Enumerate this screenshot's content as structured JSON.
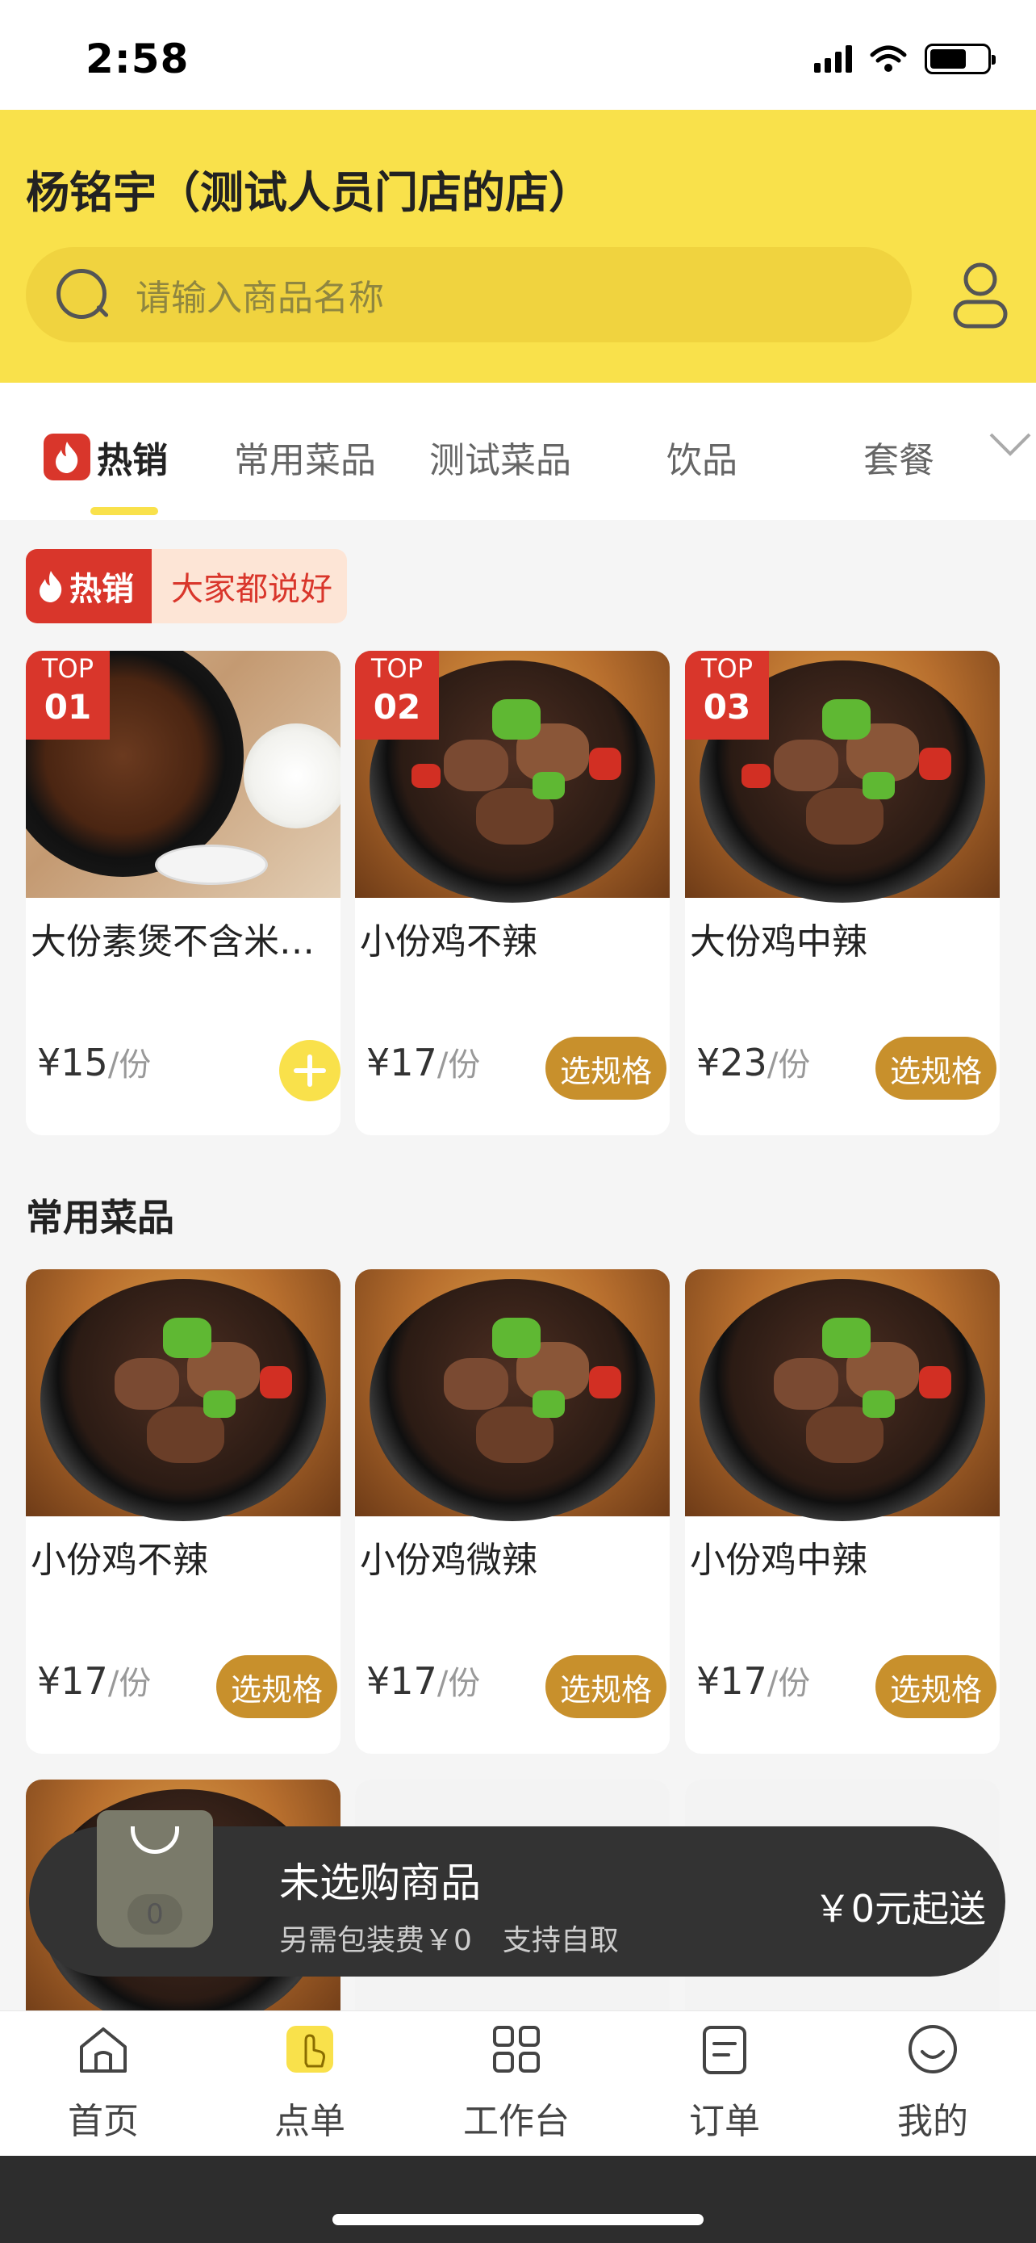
{
  "status_bar": {
    "time": "2:58"
  },
  "header": {
    "store_name": "杨铭宇（测试人员门店的店）",
    "search_placeholder": "请输入商品名称"
  },
  "tabs": [
    {
      "label": "热销",
      "active": true
    },
    {
      "label": "常用菜品",
      "active": false
    },
    {
      "label": "测试菜品",
      "active": false
    },
    {
      "label": "饮品",
      "active": false
    },
    {
      "label": "套餐",
      "active": false
    }
  ],
  "hot_banner": {
    "tag": "热销",
    "slogan": "大家都说好"
  },
  "hot_items": [
    {
      "rank_top": "TOP",
      "rank_num": "01",
      "name": "大份素煲不含米…",
      "price": "¥15",
      "unit": "/份",
      "action": "add"
    },
    {
      "rank_top": "TOP",
      "rank_num": "02",
      "name": "小份鸡不辣",
      "price": "¥17",
      "unit": "/份",
      "action": "选规格"
    },
    {
      "rank_top": "TOP",
      "rank_num": "03",
      "name": "大份鸡中辣",
      "price": "¥23",
      "unit": "/份",
      "action": "选规格"
    }
  ],
  "common_section": {
    "title": "常用菜品",
    "items": [
      {
        "name": "小份鸡不辣",
        "price": "¥17",
        "unit": "/份",
        "action": "选规格"
      },
      {
        "name": "小份鸡微辣",
        "price": "¥17",
        "unit": "/份",
        "action": "选规格"
      },
      {
        "name": "小份鸡中辣",
        "price": "¥17",
        "unit": "/份",
        "action": "选规格"
      }
    ]
  },
  "cart": {
    "count": "0",
    "title": "未选购商品",
    "packaging_fee": "另需包装费￥0",
    "pickup": "支持自取",
    "min_order": "￥0元起送"
  },
  "bottom_nav": [
    {
      "label": "首页",
      "icon": "home-icon"
    },
    {
      "label": "点单",
      "icon": "order-hand-icon",
      "active": true
    },
    {
      "label": "工作台",
      "icon": "grid-icon"
    },
    {
      "label": "订单",
      "icon": "receipt-icon"
    },
    {
      "label": "我的",
      "icon": "smile-icon"
    }
  ],
  "colors": {
    "brand_yellow": "#f9e14b",
    "hot_red": "#d9362b",
    "spec_button": "#c8902c",
    "cart_bg": "#333333"
  }
}
